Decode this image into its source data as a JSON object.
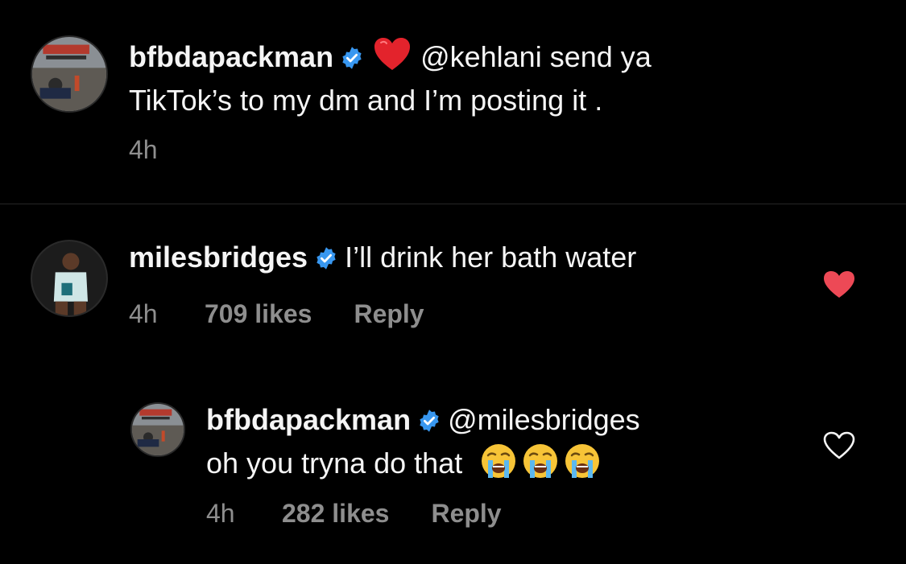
{
  "comments": [
    {
      "username": "bfbdapackman",
      "verified": true,
      "emoji": "heart",
      "mention": "@kehlani",
      "text_line1": " send ya",
      "text_line2": "TikTok’s to my dm and I’m posting it .",
      "time": "4h"
    },
    {
      "username": "milesbridges",
      "verified": true,
      "text": "I’ll drink her bath water",
      "time": "4h",
      "likes": "709 likes",
      "reply_label": "Reply",
      "liked": true
    },
    {
      "username": "bfbdapackman",
      "verified": true,
      "mention": "@milesbridges",
      "text": "oh you tryna do that",
      "emojis": [
        "loudly-crying-face",
        "loudly-crying-face",
        "loudly-crying-face"
      ],
      "time": "4h",
      "likes": "282 likes",
      "reply_label": "Reply",
      "liked": false
    }
  ],
  "colors": {
    "background": "#000000",
    "text": "#f5f5f5",
    "meta": "#8e8e8e",
    "verified": "#3897f0",
    "liked_heart": "#ed4956"
  }
}
